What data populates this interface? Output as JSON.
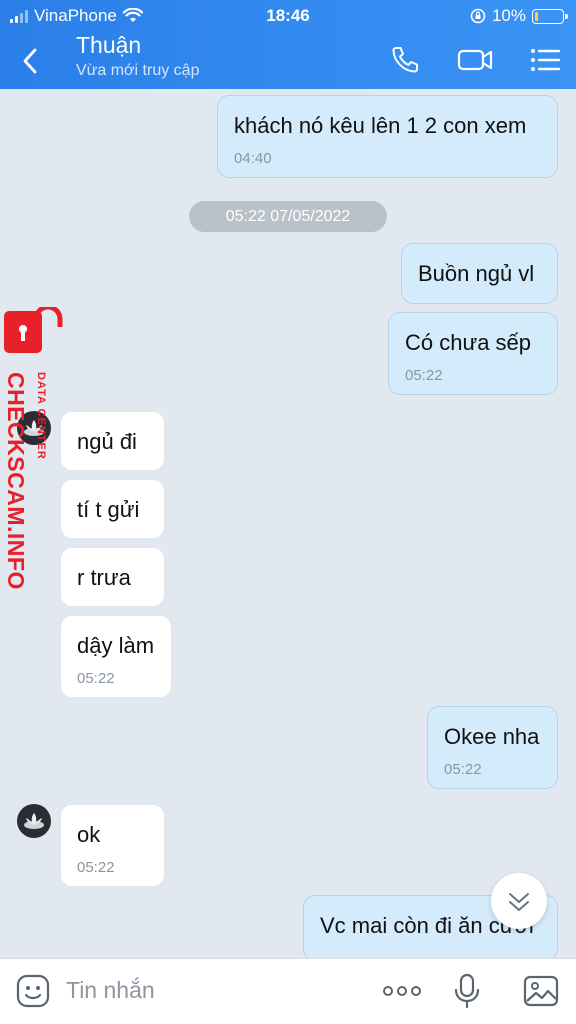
{
  "status_bar": {
    "carrier": "VinaPhone",
    "time": "18:46",
    "battery": "10%",
    "battery_level": 0.1
  },
  "header": {
    "title": "Thuận",
    "subtitle": "Vừa mới truy cập",
    "icons": [
      "back-icon",
      "phone-icon",
      "video-icon",
      "menu-icon"
    ]
  },
  "watermark": {
    "main": "CHECKSCAM.INFO",
    "sub": "DATA CENTER"
  },
  "messages": [
    {
      "dir": "out",
      "text": "khách nó kêu lên 1 2 con xem",
      "time": "04:40"
    },
    {
      "dir": "out",
      "text": "Buồn ngủ vl",
      "time": ""
    },
    {
      "dir": "out",
      "text": "Có chưa sếp",
      "time": "05:22"
    },
    {
      "dir": "in",
      "text": "ngủ đi",
      "time": ""
    },
    {
      "dir": "in",
      "text": "tí t gửi",
      "time": ""
    },
    {
      "dir": "in",
      "text": "r trưa",
      "time": ""
    },
    {
      "dir": "in",
      "text": "dậy làm",
      "time": "05:22"
    },
    {
      "dir": "out",
      "text": "Okee nha",
      "time": "05:22"
    },
    {
      "dir": "in",
      "text": "ok",
      "time": "05:22"
    },
    {
      "dir": "out",
      "text": "Vc mai còn đi ăn cưới",
      "time": ""
    }
  ],
  "date_separator": "05:22 07/05/2022",
  "input": {
    "placeholder": "Tin nhắn"
  },
  "colors": {
    "header": "#2f88ee",
    "outgoing_bubble": "#d3ebfb",
    "incoming_bubble": "#ffffff",
    "background": "#e2e8ef",
    "watermark": "#e8202a"
  }
}
